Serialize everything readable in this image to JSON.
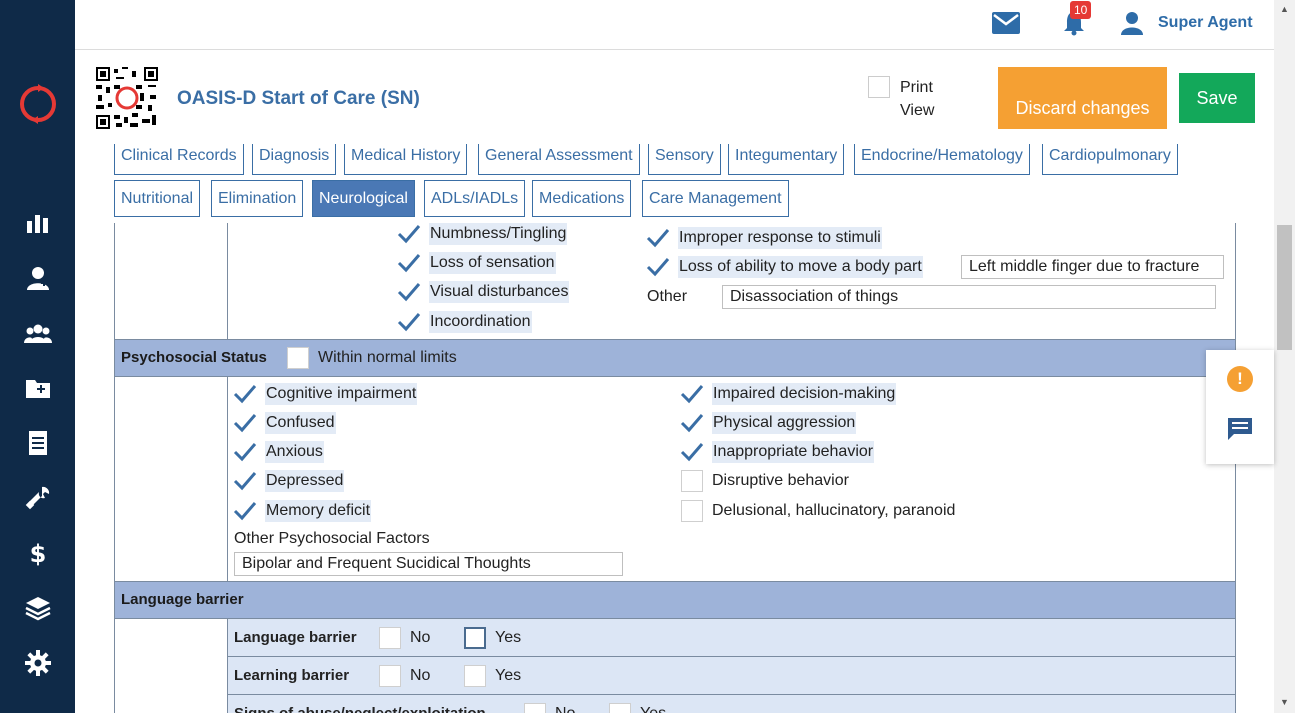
{
  "topbar": {
    "notification_count": "10",
    "user_name": "Super Agent"
  },
  "header": {
    "title": "OASIS-D Start of Care (SN)",
    "print_view_label": "Print View",
    "print_view_checked": false,
    "discard_label": "Discard changes",
    "save_label": "Save"
  },
  "tabs": [
    {
      "label": "Clinical Records",
      "active": false
    },
    {
      "label": "Diagnosis",
      "active": false
    },
    {
      "label": "Medical History",
      "active": false
    },
    {
      "label": "General Assessment",
      "active": false
    },
    {
      "label": "Sensory",
      "active": false
    },
    {
      "label": "Integumentary",
      "active": false
    },
    {
      "label": "Endocrine/Hematology",
      "active": false
    },
    {
      "label": "Cardiopulmonary",
      "active": false
    },
    {
      "label": "Nutritional",
      "active": false
    },
    {
      "label": "Elimination",
      "active": false
    },
    {
      "label": "Neurological",
      "active": true
    },
    {
      "label": "ADLs/IADLs",
      "active": false
    },
    {
      "label": "Medications",
      "active": false
    },
    {
      "label": "Care Management",
      "active": false
    }
  ],
  "neuro": {
    "left_items": [
      {
        "label": "Numbness/Tingling",
        "checked": true
      },
      {
        "label": "Loss of sensation",
        "checked": true
      },
      {
        "label": "Visual disturbances",
        "checked": true
      },
      {
        "label": "Incoordination",
        "checked": true
      }
    ],
    "right_items": [
      {
        "label": "Improper response to stimuli",
        "checked": true
      },
      {
        "label": "Loss of ability to move a body part",
        "checked": true
      }
    ],
    "body_part_detail": "Left middle finger due to fracture",
    "other_label": "Other",
    "other_value": "Disassociation of things"
  },
  "psychosocial": {
    "title": "Psychosocial Status",
    "wnl_label": "Within normal limits",
    "wnl_checked": false,
    "left_items": [
      {
        "label": "Cognitive impairment",
        "checked": true
      },
      {
        "label": "Confused",
        "checked": true
      },
      {
        "label": "Anxious",
        "checked": true
      },
      {
        "label": "Depressed",
        "checked": true
      },
      {
        "label": "Memory deficit",
        "checked": true
      }
    ],
    "right_items": [
      {
        "label": "Impaired decision-making",
        "checked": true
      },
      {
        "label": "Physical aggression",
        "checked": true
      },
      {
        "label": "Inappropriate behavior",
        "checked": true
      },
      {
        "label": "Disruptive behavior",
        "checked": false
      },
      {
        "label": "Delusional, hallucinatory, paranoid",
        "checked": false
      }
    ],
    "other_label": "Other Psychosocial Factors",
    "other_value": "Bipolar and Frequent Sucidical Thoughts"
  },
  "language": {
    "title": "Language barrier",
    "rows": [
      {
        "label": "Language barrier",
        "no": "No",
        "yes": "Yes"
      },
      {
        "label": "Learning barrier",
        "no": "No",
        "yes": "Yes"
      },
      {
        "label": "Signs of abuse/neglect/exploitation",
        "no": "No",
        "yes": "Yes"
      }
    ]
  },
  "icons": {
    "sidebar": [
      "logo-icon",
      "chart-icon",
      "patient-icon",
      "group-icon",
      "folder-add-icon",
      "document-icon",
      "wrench-icon",
      "dollar-icon",
      "layers-icon",
      "gear-icon"
    ],
    "accent": "#3a6ea5",
    "sidebar_bg": "#0f2a48",
    "discard_color": "#f5a033",
    "save_color": "#13a85a"
  }
}
